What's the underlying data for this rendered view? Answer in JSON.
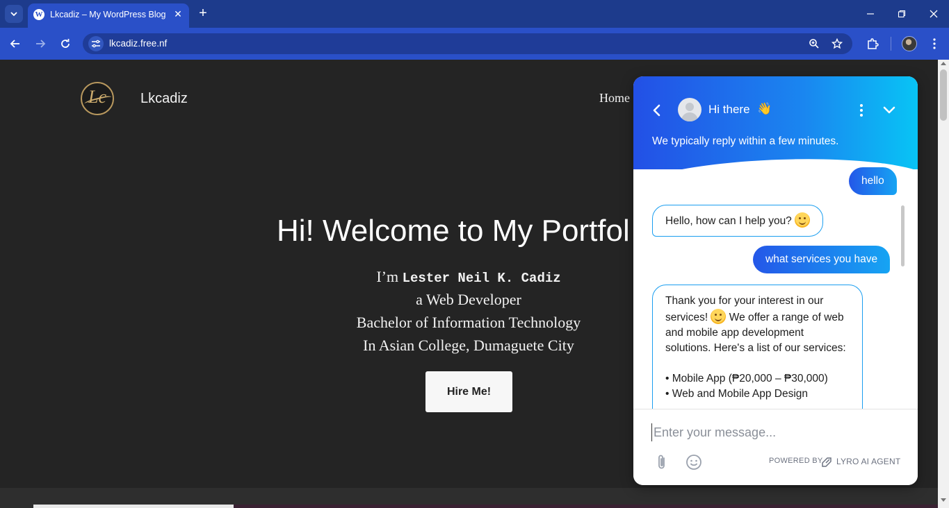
{
  "browser": {
    "tab_title": "Lkcadiz – My WordPress Blog",
    "url": "lkcadiz.free.nf"
  },
  "site": {
    "name": "Lkcadiz",
    "nav_home": "Home",
    "hero_title": "Hi! Welcome to My Portfol",
    "intro_prefix": "I’m",
    "intro_name": "Lester Neil K. Cadiz",
    "line2": "a Web Developer",
    "line3": "Bachelor of Information Technology",
    "line4": "In Asian College, Dumaguete City",
    "hire_button": "Hire Me!"
  },
  "chat": {
    "title": "Hi there",
    "subtitle": "We typically reply within a few minutes.",
    "messages": [
      {
        "from": "user",
        "text": "hello"
      },
      {
        "from": "bot",
        "text": "Hello, how can I help you?"
      },
      {
        "from": "user",
        "text": "what services you have"
      },
      {
        "from": "bot",
        "text_a": "Thank you for your interest in our services!",
        "text_b": "We offer a range of web and mobile app development solutions. Here's a list of our services:",
        "item1": "• Mobile App (₱20,000 – ₱30,000)",
        "item2": "• Web and Mobile App Design"
      }
    ],
    "input_placeholder": "Enter your message...",
    "powered_by": "POWERED BY",
    "powered_brand": "LYRO AI AGENT"
  },
  "colors": {
    "chrome_blue": "#2a50c8",
    "page_bg": "#242424",
    "chat_gradient_start": "#2350e6",
    "chat_gradient_end": "#08c4f5"
  }
}
